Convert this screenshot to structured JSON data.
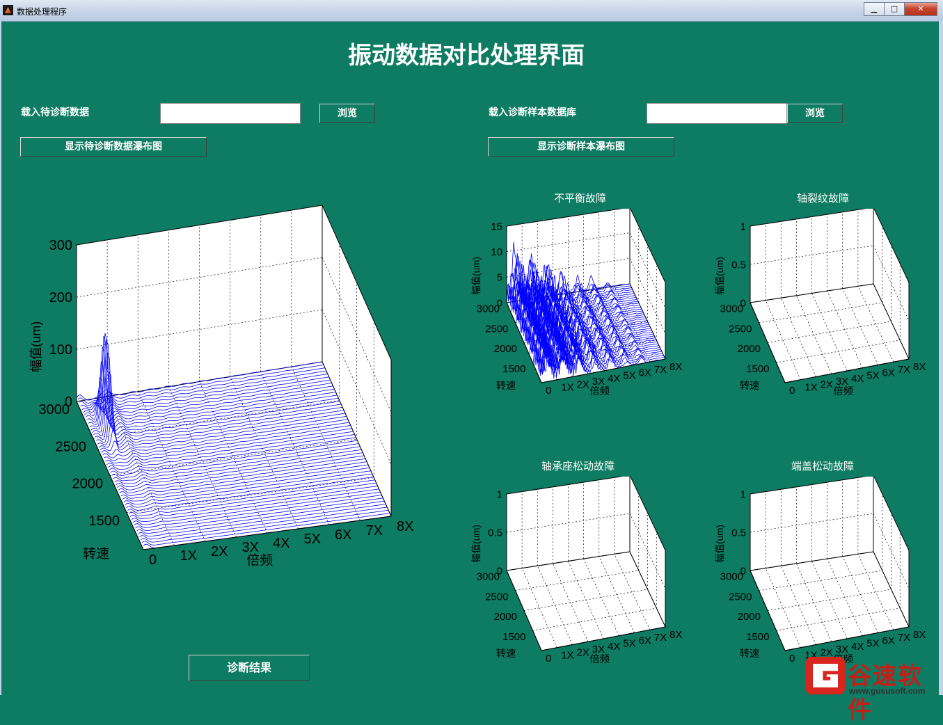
{
  "window": {
    "title": "数据处理程序",
    "controls": {
      "minimize": "▁",
      "maximize": "□",
      "close": "✕"
    }
  },
  "page_title": "振动数据对比处理界面",
  "left_panel": {
    "load_label": "载入待诊断数据",
    "load_input_value": "",
    "browse_label": "浏览",
    "show_waterfall_label": "显示待诊断数据瀑布图",
    "diagnose_label": "诊断结果"
  },
  "right_panel": {
    "load_label": "载入诊断样本数据库",
    "load_input_value": "",
    "browse_label": "浏览",
    "show_waterfall_label": "显示诊断样本瀑布图"
  },
  "watermark": {
    "brand": "谷速软件",
    "url": "www.gususoft.com"
  },
  "chart_data": [
    {
      "type": "waterfall",
      "title": "",
      "zlabel": "幅值(um)",
      "ylabel": "转速",
      "xlabel": "倍频",
      "z_ticks": [
        "0",
        "100",
        "200",
        "300"
      ],
      "y_ticks": [
        "1500",
        "2000",
        "2500",
        "3000"
      ],
      "x_ticks": [
        "0",
        "1X",
        "2X",
        "3X",
        "4X",
        "5X",
        "6X",
        "7X",
        "8X"
      ],
      "zlim": [
        0,
        300
      ],
      "has_traces": true,
      "line_color": "#0000ff"
    },
    {
      "type": "waterfall",
      "title": "不平衡故障",
      "zlabel": "幅值(um)",
      "ylabel": "转速",
      "xlabel": "倍频",
      "z_ticks": [
        "0",
        "5",
        "10",
        "15"
      ],
      "y_ticks": [
        "1500",
        "2000",
        "2500",
        "3000"
      ],
      "x_ticks": [
        "0",
        "1X",
        "2X",
        "3X",
        "4X",
        "5X",
        "6X",
        "7X",
        "8X"
      ],
      "zlim": [
        0,
        15
      ],
      "has_traces": true,
      "line_color": "#0000ff"
    },
    {
      "type": "waterfall",
      "title": "轴裂纹故障",
      "zlabel": "幅值(um)",
      "ylabel": "转速",
      "xlabel": "倍频",
      "z_ticks": [
        "0",
        "0.5",
        "1"
      ],
      "y_ticks": [
        "1500",
        "2000",
        "2500",
        "3000"
      ],
      "x_ticks": [
        "0",
        "1X",
        "2X",
        "3X",
        "4X",
        "5X",
        "6X",
        "7X",
        "8X"
      ],
      "zlim": [
        0,
        1
      ],
      "has_traces": false
    },
    {
      "type": "waterfall",
      "title": "轴承座松动故障",
      "zlabel": "幅值(um)",
      "ylabel": "转速",
      "xlabel": "倍频",
      "z_ticks": [
        "0",
        "0.5",
        "1"
      ],
      "y_ticks": [
        "1500",
        "2000",
        "2500",
        "3000"
      ],
      "x_ticks": [
        "0",
        "1X",
        "2X",
        "3X",
        "4X",
        "5X",
        "6X",
        "7X",
        "8X"
      ],
      "zlim": [
        0,
        1
      ],
      "has_traces": false
    },
    {
      "type": "waterfall",
      "title": "端盖松动故障",
      "zlabel": "幅值(um)",
      "ylabel": "转速",
      "xlabel": "倍频",
      "z_ticks": [
        "0",
        "0.5",
        "1"
      ],
      "y_ticks": [
        "1500",
        "2000",
        "2500",
        "3000"
      ],
      "x_ticks": [
        "0",
        "1X",
        "2X",
        "3X",
        "4X",
        "5X",
        "6X",
        "7X",
        "8X"
      ],
      "zlim": [
        0,
        1
      ],
      "has_traces": false
    }
  ]
}
